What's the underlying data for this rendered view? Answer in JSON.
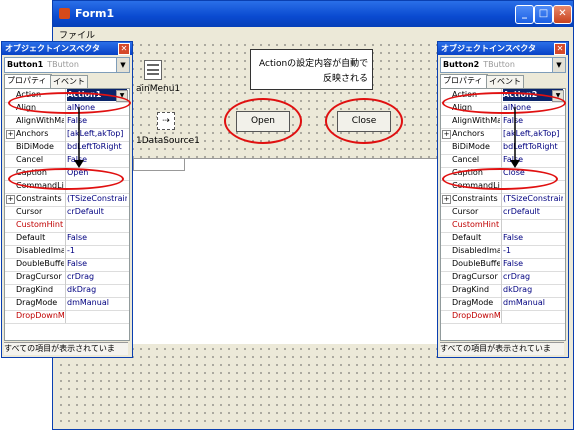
{
  "window": {
    "title": "Form1",
    "menu": "ファイル"
  },
  "form": {
    "main_menu_label": "ainMenu1",
    "datasource_label": "1DataSource1",
    "callout": [
      "Actionの設定内容が自動で",
      "反映される"
    ],
    "open_button": "Open",
    "close_button": "Close"
  },
  "left_inspector": {
    "title": "オブジェクトインスペクタ",
    "component": "Button1",
    "component_type": "TButton",
    "tabs": [
      "プロパティ",
      "イベント"
    ],
    "status": "すべての項目が表示されていま",
    "rows": [
      {
        "name": "Action",
        "value": "Action1"
      },
      {
        "name": "Align",
        "value": "alNone"
      },
      {
        "name": "AlignWithMa",
        "value": "False"
      },
      {
        "name": "Anchors",
        "value": "[akLeft,akTop]"
      },
      {
        "name": "BiDiMode",
        "value": "bdLeftToRight"
      },
      {
        "name": "Cancel",
        "value": "False"
      },
      {
        "name": "Caption",
        "value": "Open"
      },
      {
        "name": "CommandLi",
        "value": ""
      },
      {
        "name": "Constraints",
        "value": "(TSizeConstrair"
      },
      {
        "name": "Cursor",
        "value": "crDefault"
      },
      {
        "name": "CustomHint",
        "value": ""
      },
      {
        "name": "Default",
        "value": "False"
      },
      {
        "name": "DisabledIma",
        "value": "-1"
      },
      {
        "name": "DoubleBuffe",
        "value": "False"
      },
      {
        "name": "DragCursor",
        "value": "crDrag"
      },
      {
        "name": "DragKind",
        "value": "dkDrag"
      },
      {
        "name": "DragMode",
        "value": "dmManual"
      },
      {
        "name": "DropDownM",
        "value": ""
      }
    ]
  },
  "right_inspector": {
    "title": "オブジェクトインスペクタ",
    "component": "Button2",
    "component_type": "TButton",
    "tabs": [
      "プロパティ",
      "イベント"
    ],
    "status": "すべての項目が表示されていま",
    "rows": [
      {
        "name": "Action",
        "value": "Action2"
      },
      {
        "name": "Align",
        "value": "alNone"
      },
      {
        "name": "AlignWithMa",
        "value": "False"
      },
      {
        "name": "Anchors",
        "value": "[akLeft,akTop]"
      },
      {
        "name": "BiDiMode",
        "value": "bdLeftToRight"
      },
      {
        "name": "Cancel",
        "value": "False"
      },
      {
        "name": "Caption",
        "value": "Close"
      },
      {
        "name": "CommandLi",
        "value": ""
      },
      {
        "name": "Constraints",
        "value": "(TSizeConstrair"
      },
      {
        "name": "Cursor",
        "value": "crDefault"
      },
      {
        "name": "CustomHint",
        "value": ""
      },
      {
        "name": "Default",
        "value": "False"
      },
      {
        "name": "DisabledIma",
        "value": "-1"
      },
      {
        "name": "DoubleBuffe",
        "value": "False"
      },
      {
        "name": "DragCursor",
        "value": "crDrag"
      },
      {
        "name": "DragKind",
        "value": "dkDrag"
      },
      {
        "name": "DragMode",
        "value": "dmManual"
      },
      {
        "name": "DropDownM",
        "value": ""
      }
    ]
  }
}
